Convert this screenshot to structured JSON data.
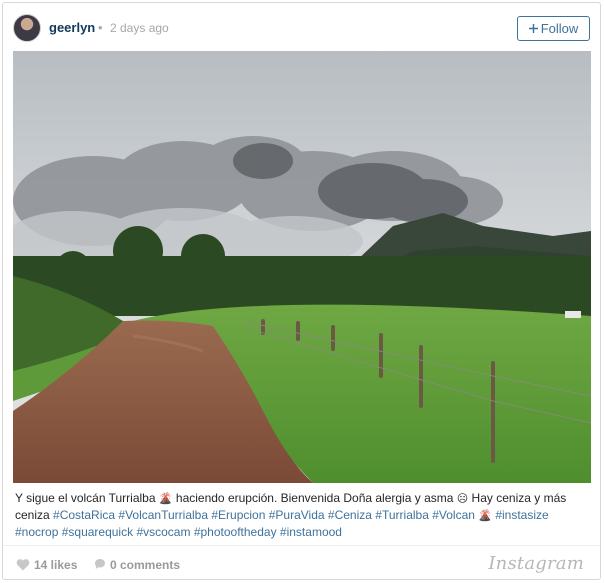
{
  "header": {
    "username": "geerlyn",
    "separator": "•",
    "timestamp": "2 days ago",
    "follow_label": "Follow",
    "follow_icon": "plus-icon"
  },
  "photo": {
    "kind": "landscape photograph of volcano eruption over a dirt road"
  },
  "caption": {
    "segments": [
      {
        "text": "Y sigue el volcán Turrialba ",
        "type": "text"
      },
      {
        "text": "🌋",
        "type": "emoji"
      },
      {
        "text": " haciendo erupción. Bienvenida Doña alergia y asma ",
        "type": "text"
      },
      {
        "text": "☹",
        "type": "emoji"
      },
      {
        "text": " Hay ceniza y más ceniza ",
        "type": "text"
      },
      {
        "text": "#CostaRica",
        "type": "tag"
      },
      {
        "text": " ",
        "type": "text"
      },
      {
        "text": "#VolcanTurrialba",
        "type": "tag"
      },
      {
        "text": " ",
        "type": "text"
      },
      {
        "text": "#Erupcion",
        "type": "tag"
      },
      {
        "text": " ",
        "type": "text"
      },
      {
        "text": "#PuraVida",
        "type": "tag"
      },
      {
        "text": " ",
        "type": "text"
      },
      {
        "text": "#Ceniza",
        "type": "tag"
      },
      {
        "text": " ",
        "type": "text"
      },
      {
        "text": "#Turrialba",
        "type": "tag"
      },
      {
        "text": " ",
        "type": "text"
      },
      {
        "text": "#Volcan",
        "type": "tag"
      },
      {
        "text": " ",
        "type": "text"
      },
      {
        "text": "🌋",
        "type": "emoji"
      },
      {
        "text": " ",
        "type": "text"
      },
      {
        "text": "#instasize",
        "type": "tag"
      },
      {
        "text": " ",
        "type": "text"
      },
      {
        "text": "#nocrop",
        "type": "tag"
      },
      {
        "text": " ",
        "type": "text"
      },
      {
        "text": "#squarequick",
        "type": "tag"
      },
      {
        "text": " ",
        "type": "text"
      },
      {
        "text": "#vscocam",
        "type": "tag"
      },
      {
        "text": " ",
        "type": "text"
      },
      {
        "text": "#photooftheday",
        "type": "tag"
      },
      {
        "text": " ",
        "type": "text"
      },
      {
        "text": "#instamood",
        "type": "tag"
      }
    ]
  },
  "footer": {
    "likes": "14 likes",
    "comments": "0 comments",
    "brand": "Instagram",
    "like_icon": "heart-icon",
    "comment_icon": "comment-bubble-icon"
  },
  "colors": {
    "link": "#3f729b",
    "username": "#12395b",
    "muted": "#a7a7a7",
    "border": "#d7d7d7"
  }
}
